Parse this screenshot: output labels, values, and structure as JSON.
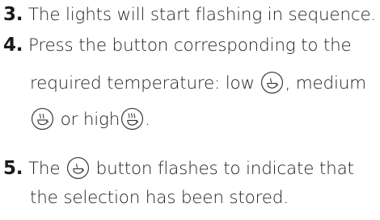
{
  "steps": [
    {
      "number": "3.",
      "line1": " The lights will start flashing in sequence."
    },
    {
      "number": "4.",
      "line1": " Press the button corresponding to the",
      "line2": "required temperature: low ",
      "line2_after_low": ", medium",
      "line3_after_medium": " or high",
      "line3_end": "."
    },
    {
      "number": "5.",
      "line1_before": " The ",
      "line1_after": " button flashes to indicate that",
      "line2": "the selection has been stored."
    }
  ],
  "icons": {
    "low": "cup-low-temperature-icon",
    "medium": "cup-medium-temperature-icon",
    "high": "cup-high-temperature-icon"
  }
}
